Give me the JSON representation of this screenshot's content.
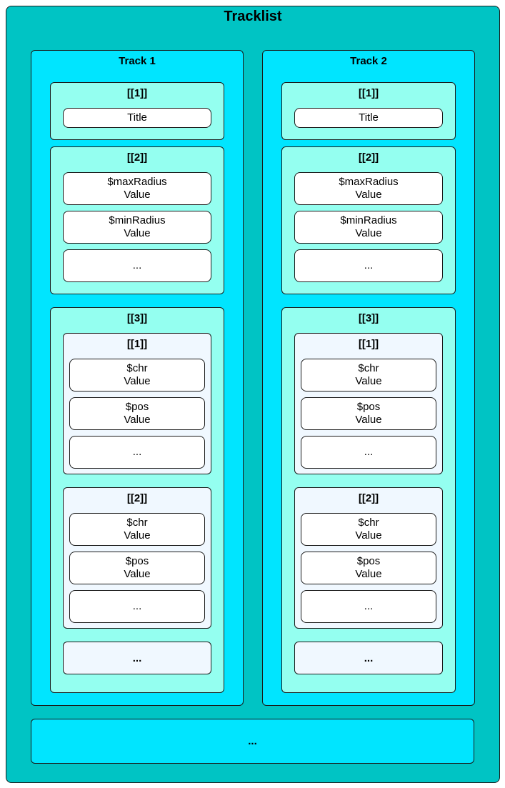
{
  "tracklist": {
    "title": "Tracklist",
    "bottom_more": "...",
    "tracks": [
      {
        "title": "Track 1",
        "group1": {
          "title": "[[1]]",
          "field": "Title"
        },
        "group2": {
          "title": "[[2]]",
          "max_label": "$maxRadius",
          "max_value": "Value",
          "min_label": "$minRadius",
          "min_value": "Value",
          "more": "..."
        },
        "group3": {
          "title": "[[3]]",
          "subs": [
            {
              "title": "[[1]]",
              "chr_label": "$chr",
              "chr_value": "Value",
              "pos_label": "$pos",
              "pos_value": "Value",
              "more": "..."
            },
            {
              "title": "[[2]]",
              "chr_label": "$chr",
              "chr_value": "Value",
              "pos_label": "$pos",
              "pos_value": "Value",
              "more": "..."
            }
          ],
          "more": "..."
        }
      },
      {
        "title": "Track 2",
        "group1": {
          "title": "[[1]]",
          "field": "Title"
        },
        "group2": {
          "title": "[[2]]",
          "max_label": "$maxRadius",
          "max_value": "Value",
          "min_label": "$minRadius",
          "min_value": "Value",
          "more": "..."
        },
        "group3": {
          "title": "[[3]]",
          "subs": [
            {
              "title": "[[1]]",
              "chr_label": "$chr",
              "chr_value": "Value",
              "pos_label": "$pos",
              "pos_value": "Value",
              "more": "..."
            },
            {
              "title": "[[2]]",
              "chr_label": "$chr",
              "chr_value": "Value",
              "pos_label": "$pos",
              "pos_value": "Value",
              "more": "..."
            }
          ],
          "more": "..."
        }
      }
    ]
  },
  "colors": {
    "outer": "#00c4c4",
    "track": "#00e5ff",
    "group": "#94fff0",
    "sub": "#f0f8ff",
    "field": "#ffffff"
  }
}
